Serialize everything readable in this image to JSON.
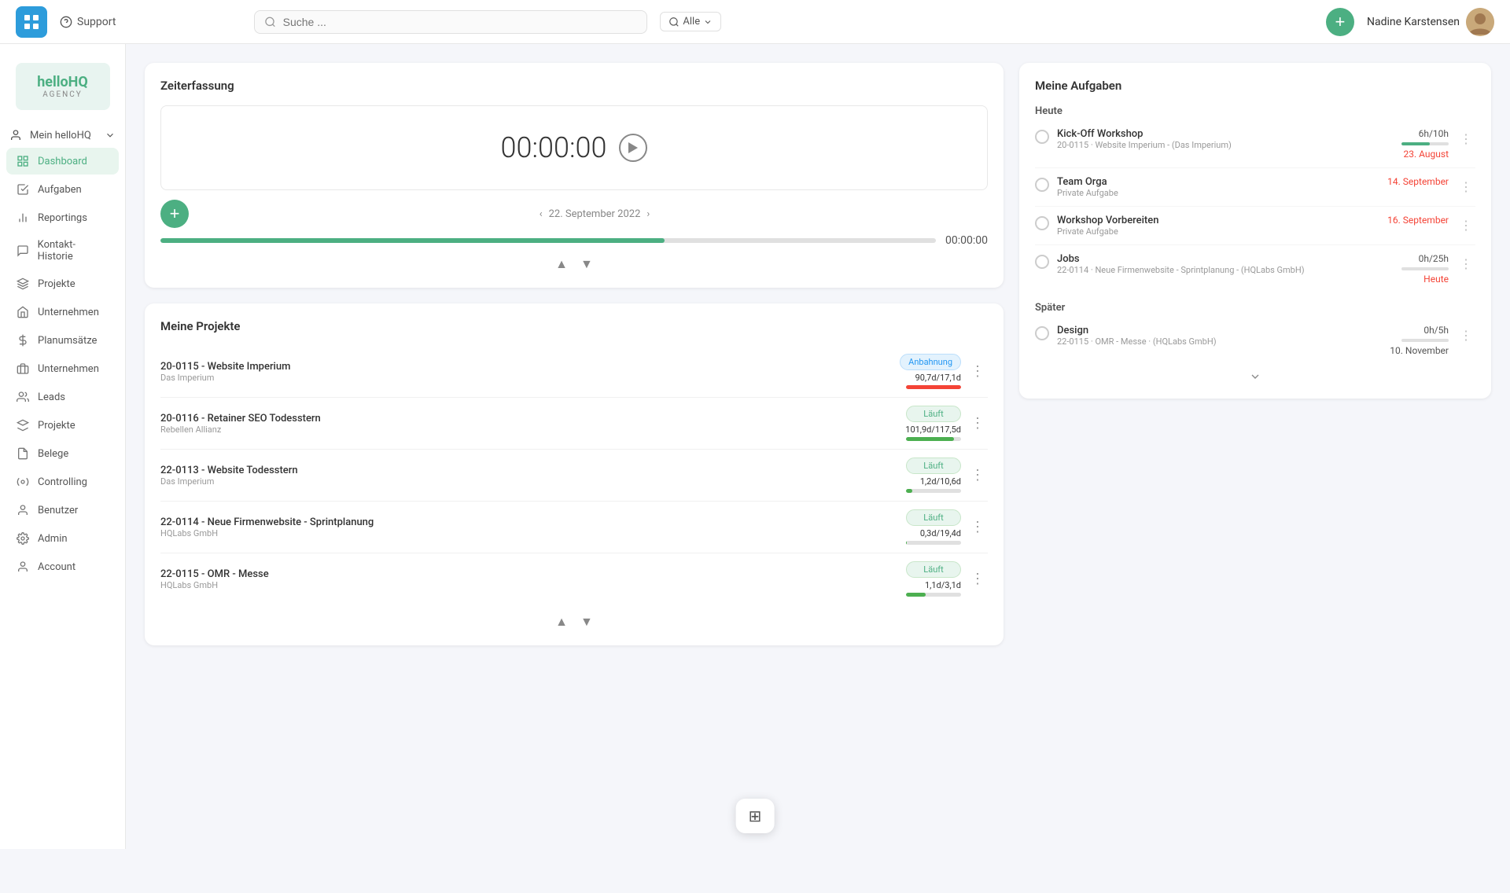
{
  "app": {
    "logo_text": "H",
    "brand_name": "helloHQ",
    "brand_sub": "AGENCY"
  },
  "topnav": {
    "support_label": "Support",
    "search_placeholder": "Suche ...",
    "filter_label": "Alle",
    "add_button_label": "+",
    "user_name": "Nadine Karstensen"
  },
  "sidebar": {
    "mein_label": "Mein helloHQ",
    "items": [
      {
        "id": "dashboard",
        "label": "Dashboard",
        "active": true
      },
      {
        "id": "aufgaben",
        "label": "Aufgaben",
        "active": false
      },
      {
        "id": "reportings",
        "label": "Reportings",
        "active": false
      },
      {
        "id": "kontakt-historie",
        "label": "Kontakt-Historie",
        "active": false
      },
      {
        "id": "projekte-top",
        "label": "Projekte",
        "active": false
      },
      {
        "id": "unternehmen-top",
        "label": "Unternehmen",
        "active": false
      },
      {
        "id": "planumsatze",
        "label": "Planumsätze",
        "active": false
      },
      {
        "id": "unternehmen",
        "label": "Unternehmen",
        "active": false
      },
      {
        "id": "leads",
        "label": "Leads",
        "active": false
      },
      {
        "id": "projekte",
        "label": "Projekte",
        "active": false
      },
      {
        "id": "belege",
        "label": "Belege",
        "active": false
      },
      {
        "id": "controlling",
        "label": "Controlling",
        "active": false
      },
      {
        "id": "benutzer",
        "label": "Benutzer",
        "active": false
      },
      {
        "id": "admin",
        "label": "Admin",
        "active": false
      },
      {
        "id": "account",
        "label": "Account",
        "active": false
      }
    ]
  },
  "zeiterfassung": {
    "title": "Zeiterfassung",
    "timer": "00:00:00",
    "date": "22. September 2022",
    "progress_value": "00:00:00",
    "progress_pct": 65
  },
  "meine_projekte": {
    "title": "Meine Projekte",
    "projects": [
      {
        "id": "p1",
        "name": "20-0115 - Website Imperium",
        "client": "Das Imperium",
        "status": "Anbahnung",
        "status_type": "anbahnung",
        "value": "90,7d/17,1d",
        "bar_pct": 100,
        "bar_color": "red"
      },
      {
        "id": "p2",
        "name": "20-0116 - Retainer SEO Todesstern",
        "client": "Rebellen Allianz",
        "status": "Läuft",
        "status_type": "lauft",
        "value": "101,9d/117,5d",
        "bar_pct": 87,
        "bar_color": "green"
      },
      {
        "id": "p3",
        "name": "22-0113 - Website Todesstern",
        "client": "Das Imperium",
        "status": "Läuft",
        "status_type": "lauft",
        "value": "1,2d/10,6d",
        "bar_pct": 12,
        "bar_color": "green"
      },
      {
        "id": "p4",
        "name": "22-0114 - Neue Firmenwebsite - Sprintplanung",
        "client": "HQLabs GmbH",
        "status": "Läuft",
        "status_type": "lauft",
        "value": "0,3d/19,4d",
        "bar_pct": 2,
        "bar_color": "green"
      },
      {
        "id": "p5",
        "name": "22-0115 - OMR - Messe",
        "client": "HQLabs GmbH",
        "status": "Läuft",
        "status_type": "lauft",
        "value": "1,1d/3,1d",
        "bar_pct": 36,
        "bar_color": "green"
      }
    ]
  },
  "meine_aufgaben": {
    "title": "Meine Aufgaben",
    "heute_label": "Heute",
    "spaeter_label": "Später",
    "tasks_heute": [
      {
        "id": "t1",
        "name": "Kick-Off Workshop",
        "sub": "20-0115 · Website Imperium - (Das Imperium)",
        "time": "6h/10h",
        "bar_pct": 60,
        "date": "23. August",
        "date_style": "red"
      },
      {
        "id": "t2",
        "name": "Team Orga",
        "sub": "Private Aufgabe",
        "time": "",
        "bar_pct": 0,
        "date": "14. September",
        "date_style": "red"
      },
      {
        "id": "t3",
        "name": "Workshop Vorbereiten",
        "sub": "Private Aufgabe",
        "time": "",
        "bar_pct": 0,
        "date": "16. September",
        "date_style": "red"
      },
      {
        "id": "t4",
        "name": "Jobs",
        "sub": "22-0114 · Neue Firmenwebsite - Sprintplanung - (HQLabs GmbH)",
        "time": "0h/25h",
        "bar_pct": 0,
        "date": "Heute",
        "date_style": "red"
      }
    ],
    "tasks_spaeter": [
      {
        "id": "t5",
        "name": "Design",
        "sub": "22-0115 · OMR - Messe · (HQLabs GmbH)",
        "time": "0h/5h",
        "bar_pct": 0,
        "date": "10. November",
        "date_style": "normal"
      }
    ]
  },
  "bottom_dock": {
    "icon": "⊞"
  }
}
